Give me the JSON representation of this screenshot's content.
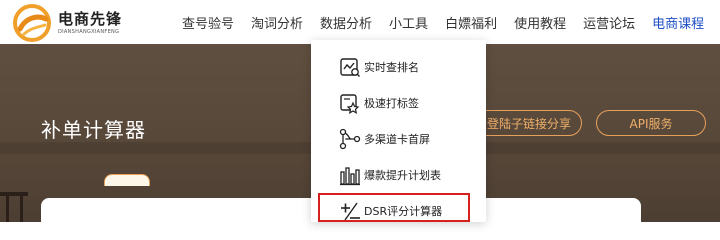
{
  "logo": {
    "title": "电商先锋",
    "subtitle": "DIANSHANGXIANFENG",
    "icon": "logo-swirl-icon"
  },
  "nav": {
    "items": [
      {
        "label": "查号验号"
      },
      {
        "label": "淘词分析"
      },
      {
        "label": "数据分析"
      },
      {
        "label": "小工具"
      },
      {
        "label": "白嫖福利"
      },
      {
        "label": "使用教程"
      },
      {
        "label": "运营论坛"
      },
      {
        "label": "电商课程"
      }
    ],
    "active_color": "#1e4fc8"
  },
  "hero": {
    "title": "补单计算器",
    "buttons": [
      {
        "label": "登陆子链接分享"
      },
      {
        "label": "API服务"
      }
    ],
    "accent": "#e7a05a"
  },
  "dropdown": {
    "items": [
      {
        "label": "实时查排名",
        "icon": "realtime-rank-icon"
      },
      {
        "label": "极速打标签",
        "icon": "tag-star-icon"
      },
      {
        "label": "多渠道卡首屏",
        "icon": "multi-channel-icon"
      },
      {
        "label": "爆款提升计划表",
        "icon": "bar-chart-icon"
      },
      {
        "label": "DSR评分计算器",
        "icon": "plus-minus-calc-icon"
      }
    ],
    "highlight_color": "#d62020"
  }
}
